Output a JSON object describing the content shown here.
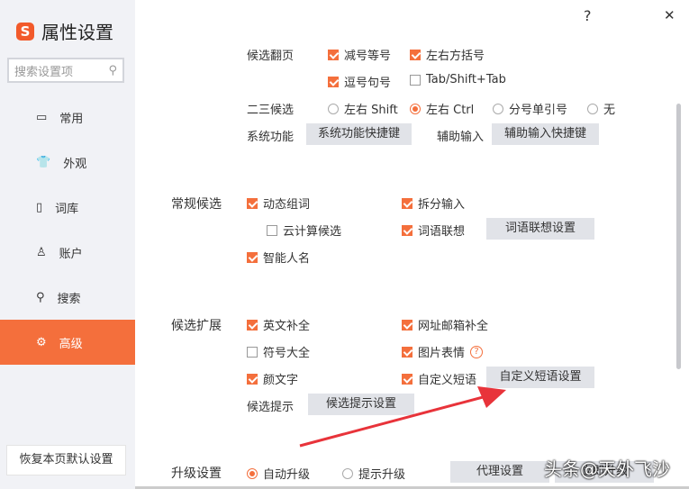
{
  "app": {
    "title": "属性设置",
    "search_placeholder": "搜索设置项",
    "help": "?",
    "close": "✕"
  },
  "sidebar": {
    "items": [
      {
        "label": "常用"
      },
      {
        "label": "外观"
      },
      {
        "label": "词库"
      },
      {
        "label": "账户"
      },
      {
        "label": "搜索"
      },
      {
        "label": "高级"
      }
    ],
    "reset": "恢复本页默认设置"
  },
  "candidate_page": {
    "label": "候选翻页",
    "minus_equal": "减号等号",
    "brackets": "左右方括号",
    "comma_period": "逗号句号",
    "tab": "Tab/Shift+Tab"
  },
  "second_third": {
    "label": "二三候选",
    "opts": [
      "左右 Shift",
      "左右 Ctrl",
      "分号单引号",
      "无"
    ]
  },
  "system": {
    "label": "系统功能",
    "btn": "系统功能快捷键",
    "aux_label": "辅助输入",
    "aux_btn": "辅助输入快捷键"
  },
  "regular": {
    "label": "常规候选",
    "dynamic": "动态组词",
    "cloud": "云计算候选",
    "smart_name": "智能人名",
    "split": "拆分输入",
    "assoc": "词语联想",
    "assoc_btn": "词语联想设置"
  },
  "extend": {
    "label": "候选扩展",
    "english": "英文补全",
    "symbols": "符号大全",
    "kaomoji": "颜文字",
    "url": "网址邮箱补全",
    "emoji": "图片表情",
    "custom": "自定义短语",
    "custom_btn": "自定义短语设置",
    "hint_label": "候选提示",
    "hint_btn": "候选提示设置"
  },
  "upgrade": {
    "label": "升级设置",
    "auto": "自动升级",
    "prompt": "提示升级",
    "proxy_btn": "代理设置",
    "now_btn": "立即升级"
  },
  "watermark": "头条@天外飞沙"
}
